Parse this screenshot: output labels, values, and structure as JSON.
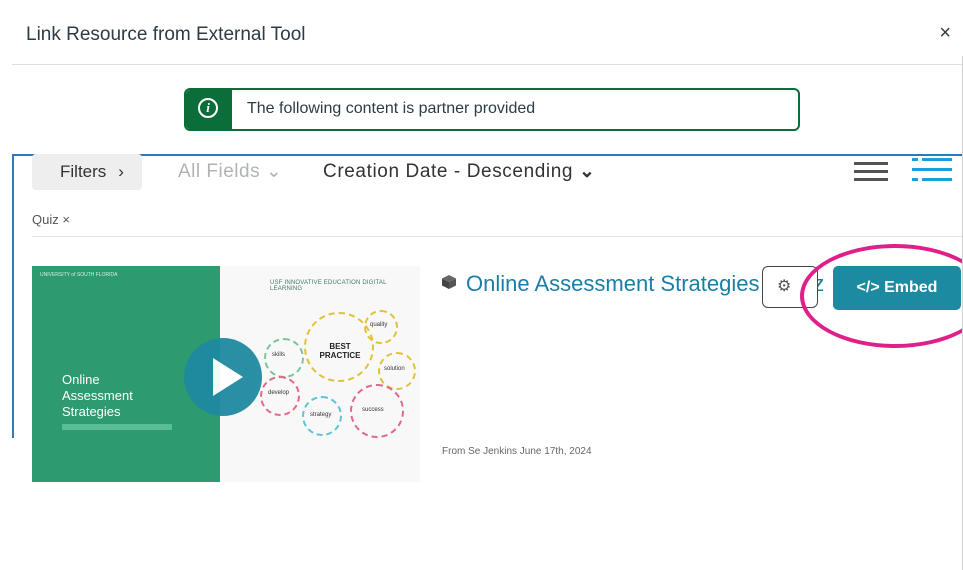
{
  "dialog": {
    "title": "Link Resource from External Tool",
    "close_label": "×"
  },
  "notice": {
    "icon": "info-icon",
    "icon_glyph": "i",
    "text": "The following content is partner provided",
    "accent_color": "#0b6e3a"
  },
  "toolbar": {
    "filters_label": "Filters",
    "filters_chevron": "›",
    "fields_select": "All Fields",
    "fields_chevron": "⌄",
    "sort_select": "Creation Date - Descending",
    "sort_chevron": "⌄",
    "view_icons": [
      "list-view-icon",
      "detailed-list-view-icon"
    ]
  },
  "active_filters": [
    {
      "label": "Quiz",
      "remove": "×"
    }
  ],
  "results": [
    {
      "title": "Online Assessment Strategies - Quiz",
      "type_icon": "cube-icon",
      "meta": "From Se Jenkins June 17th, 2024",
      "embed_label": "</> Embed",
      "thumbnail": {
        "university": "UNIVERSITY of SOUTH FLORIDA",
        "header": "USF INNOVATIVE EDUCATION DIGITAL LEARNING",
        "title_lines": [
          "Online",
          "Assessment",
          "Strategies"
        ],
        "gears": [
          "skills",
          "quality",
          "BEST PRACTICE",
          "solution",
          "develop",
          "strategy",
          "success"
        ]
      }
    }
  ],
  "colors": {
    "brand_teal": "#1c8aa0",
    "link": "#1a7fa6",
    "highlight": "#e0208a"
  }
}
